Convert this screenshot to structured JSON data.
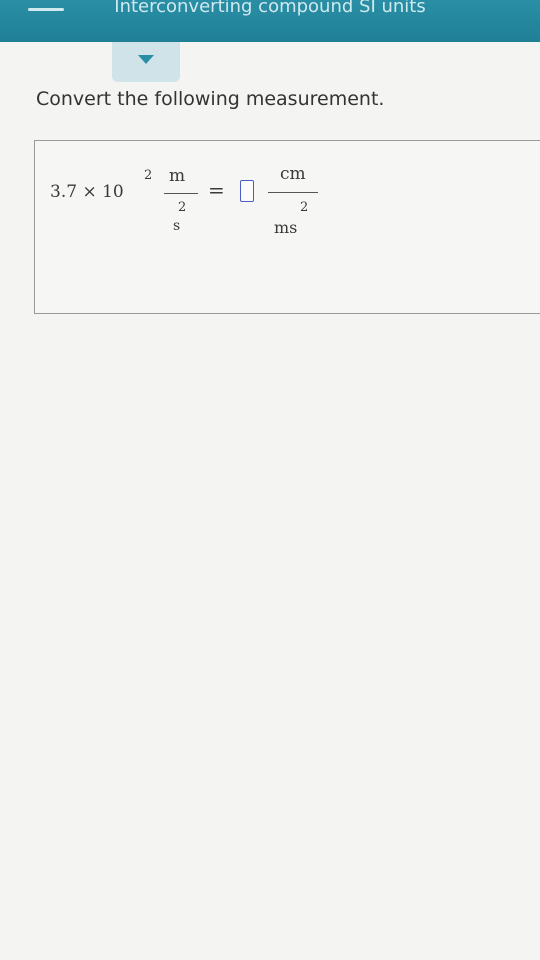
{
  "header": {
    "title": "Interconverting compound SI units"
  },
  "question": {
    "instruction": "Convert the following measurement.",
    "coefficient": "3.7 × 10",
    "exponent": "2",
    "given_unit_numerator": "m",
    "given_unit_denominator_exponent": "2",
    "given_unit_denominator": "s",
    "equals": "=",
    "target_unit_numerator": "cm",
    "target_unit_denominator_exponent": "2",
    "target_unit_denominator": "ms"
  },
  "answer": {
    "value": ""
  },
  "colors": {
    "header_bg": "#1f7f96",
    "input_border": "#4a5fc6"
  },
  "icons": {
    "menu": "menu-dash-icon",
    "collapse": "chevron-down-icon"
  }
}
